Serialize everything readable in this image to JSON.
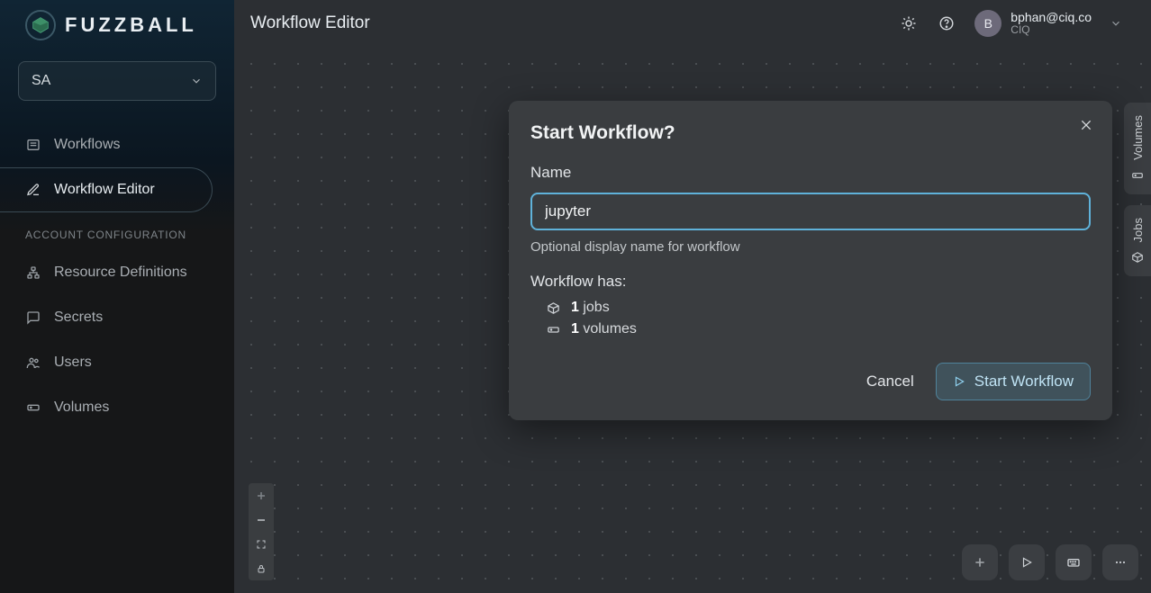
{
  "brand": "FUZZBALL",
  "project_selector": {
    "value": "SA"
  },
  "nav": {
    "workflows": "Workflows",
    "editor": "Workflow Editor",
    "section_label": "ACCOUNT CONFIGURATION",
    "resource_defs": "Resource Definitions",
    "secrets": "Secrets",
    "users": "Users",
    "volumes": "Volumes"
  },
  "topbar": {
    "title": "Workflow Editor",
    "avatar_letter": "B",
    "email": "bphan@ciq.co",
    "org": "CIQ"
  },
  "side_panels": {
    "volumes": "Volumes",
    "jobs": "Jobs"
  },
  "dialog": {
    "title": "Start Workflow?",
    "name_label": "Name",
    "name_value": "jupyter",
    "name_help": "Optional display name for workflow",
    "summary_title": "Workflow has:",
    "jobs_count": "1",
    "jobs_label": " jobs",
    "volumes_count": "1",
    "volumes_label": " volumes",
    "cancel": "Cancel",
    "confirm": "Start Workflow"
  }
}
